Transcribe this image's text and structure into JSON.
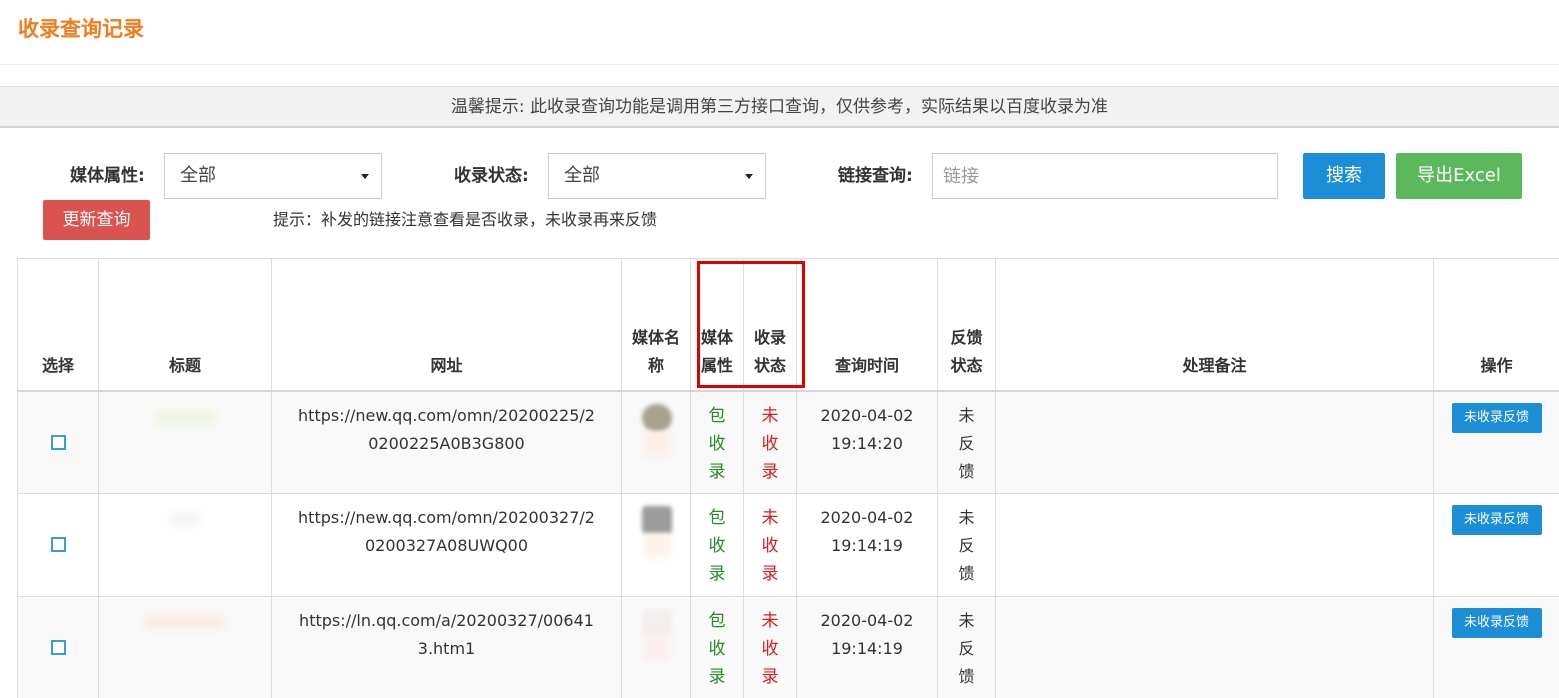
{
  "page": {
    "title": "收录查询记录",
    "notice": "温馨提示: 此收录查询功能是调用第三方接口查询，仅供参考，实际结果以百度收录为准"
  },
  "filters": {
    "media_attr_label": "媒体属性:",
    "media_attr_value": "全部",
    "index_status_label": "收录状态:",
    "index_status_value": "全部",
    "link_query_label": "链接查询:",
    "link_placeholder": "链接",
    "search_label": "搜索",
    "export_label": "导出Excel",
    "refresh_label": "更新查询",
    "hint": "提示：补发的链接注意查看是否收录，未收录再来反馈"
  },
  "table": {
    "headers": {
      "select": "选择",
      "title": "标题",
      "url": "网址",
      "media_name": "媒体名称",
      "media_attr": "媒体属性",
      "index_status": "收录状态",
      "query_time": "查询时间",
      "feedback_status": "反馈状态",
      "note": "处理备注",
      "action": "操作"
    },
    "rows": [
      {
        "url": "https://new.qq.com/omn/20200225/20200225A0B3G800",
        "media_attr": "包收录",
        "index_status": "未收录",
        "query_time_date": "2020-04-02",
        "query_time_clock": "19:14:20",
        "feedback_status": "未反馈",
        "note": "",
        "action": "未收录反馈"
      },
      {
        "url": "https://new.qq.com/omn/20200327/20200327A08UWQ00",
        "media_attr": "包收录",
        "index_status": "未收录",
        "query_time_date": "2020-04-02",
        "query_time_clock": "19:14:19",
        "feedback_status": "未反馈",
        "note": "",
        "action": "未收录反馈"
      },
      {
        "url": "https://ln.qq.com/a/20200327/006413.htm1",
        "media_attr": "包收录",
        "index_status": "未收录",
        "query_time_date": "2020-04-02",
        "query_time_clock": "19:14:19",
        "feedback_status": "未反馈",
        "note": "",
        "action": "未收录反馈"
      }
    ]
  },
  "colors": {
    "title": "#f07d1e",
    "search_button": "#1c8ed6",
    "export_button": "#5cb85c",
    "refresh_button": "#d9534f",
    "status_green": "#2a8a2a",
    "status_red": "#d42020",
    "highlight": "#e00000"
  }
}
